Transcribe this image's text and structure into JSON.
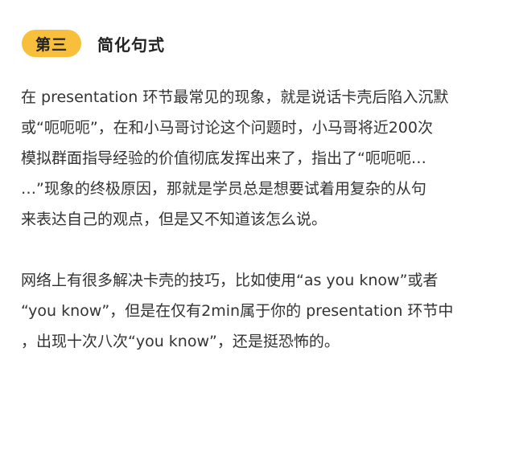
{
  "header": {
    "badge": "第三",
    "title": "简化句式"
  },
  "paragraphs": [
    {
      "lines": [
        "在 presentation 环节最常见的现象，就是说话卡壳后陷入沉默",
        "或“呃呃呃”，在和小马哥讨论这个问题时，小马哥将近200次",
        "模拟群面指导经验的价值彻底发挥出来了，指出了“呃呃呃…",
        "…”现象的终极原因，那就是学员总是想要试着用复杂的从句",
        "来表达自己的观点，但是又不知道该怎么说。"
      ]
    },
    {
      "lines": [
        "网络上有很多解决卡壳的技巧，比如使用“as you know”或者",
        "“you know”，但是在仅有2min属于你的 presentation 环节中",
        "，出现十次八次“you know”，还是挺恐怖的。"
      ]
    }
  ]
}
